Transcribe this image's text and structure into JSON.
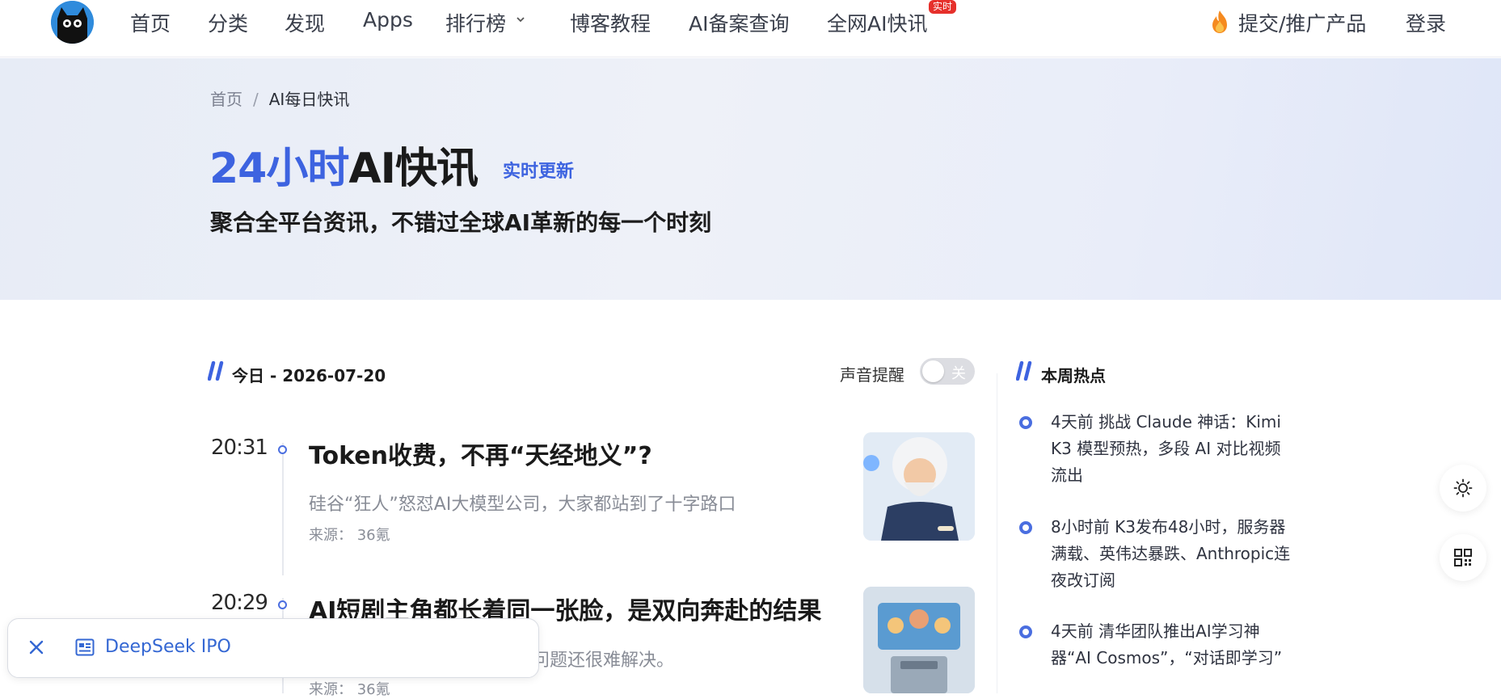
{
  "nav": {
    "items": [
      {
        "label": "首页"
      },
      {
        "label": "分类"
      },
      {
        "label": "发现"
      },
      {
        "label": "Apps"
      },
      {
        "label": "排行榜"
      },
      {
        "label": "博客教程"
      },
      {
        "label": "AI备案查询"
      },
      {
        "label": "全网AI快讯"
      }
    ],
    "live_badge": "实时",
    "submit_label": "提交/推广产品",
    "login_label": "登录"
  },
  "hero": {
    "breadcrumb": [
      "首页",
      "AI每日快讯"
    ],
    "title_blue": "24小时",
    "title_dark": "AI快讯",
    "live_tag": "实时更新",
    "subtitle": "聚合全平台资讯，不错过全球AI革新的每一个时刻"
  },
  "feed": {
    "section_title": "今日 - 2026-07-20",
    "sound_label": "声音提醒",
    "sound_state": "关",
    "source_prefix": "来源：",
    "items": [
      {
        "time": "20:31",
        "title": "Token收费，不再“天经地义”?",
        "summary": "硅谷“狂人”怒怼AI大模型公司，大家都站到了十字路口",
        "source": "36氪"
      },
      {
        "time": "20:29",
        "title": "AI短剧主角都长着同一张脸，是双向奔赴的结果",
        "summary": "个问题还很难解决。",
        "source": "36氪"
      }
    ]
  },
  "sidebar": {
    "title": "本周热点",
    "items": [
      {
        "text": "4天前 挑战 Claude 神话：Kimi K3 模型预热，多段 AI 对比视频流出"
      },
      {
        "text": "8小时前 K3发布48小时，服务器满载、英伟达暴跌、Anthropic连夜改订阅"
      },
      {
        "text": "4天前 清华团队推出AI学习神器“AI Cosmos”，“对话即学习”"
      }
    ]
  },
  "toast": {
    "text": "DeepSeek IPO"
  },
  "colors": {
    "accent": "#3d63e0",
    "badge": "#e6302b",
    "link": "#3467d3"
  },
  "icons": [
    "cat-logo-icon",
    "chevron-down-icon",
    "fire-icon",
    "slash-section-icon",
    "sun-icon",
    "qr-code-icon",
    "close-icon",
    "news-icon"
  ]
}
